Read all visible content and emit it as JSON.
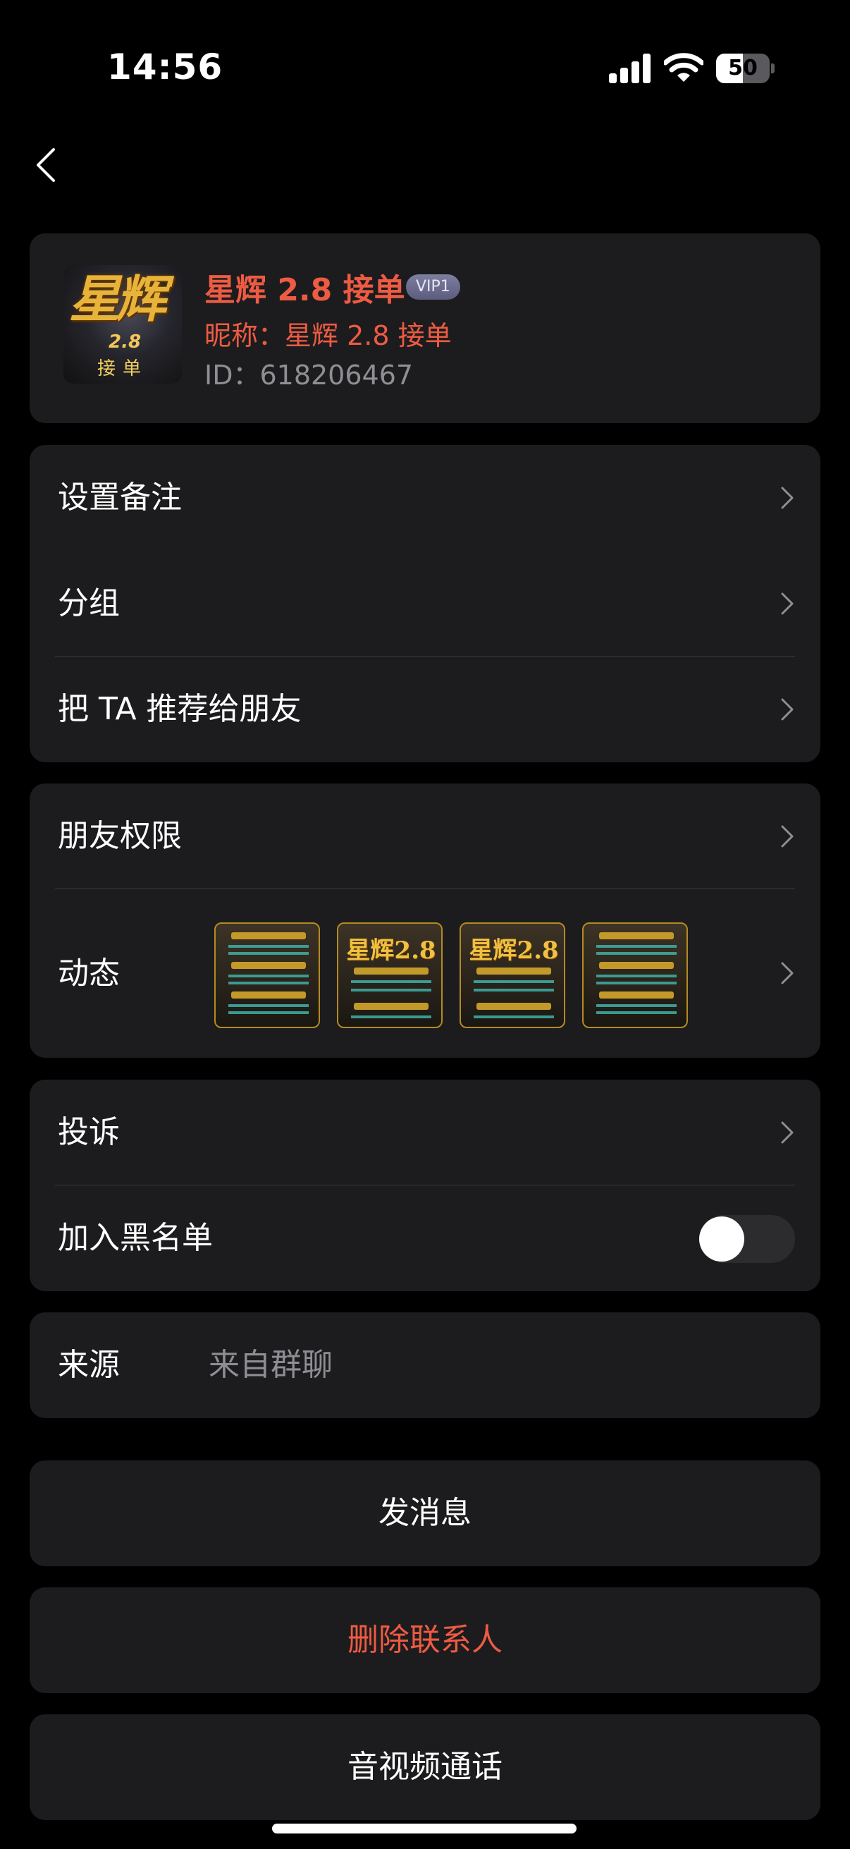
{
  "status_bar": {
    "time": "14:56",
    "battery": "50",
    "battery_level": 0.5
  },
  "profile": {
    "avatar_text": "星辉",
    "avatar_version": "2.8",
    "avatar_sub": "接单",
    "name": "星辉 2.8 接单",
    "vip_badge": "VIP1",
    "nickname": "昵称：星辉 2.8 接单",
    "id": "ID：618206467"
  },
  "settings": {
    "remark": "设置备注",
    "group": "分组",
    "recommend": "把 TA 推荐给朋友"
  },
  "privacy": {
    "permissions": "朋友权限",
    "moments": "动态",
    "moment_thumb_title": "星辉2.8"
  },
  "safety": {
    "report": "投诉",
    "blacklist": "加入黑名单",
    "blacklist_on": false
  },
  "source": {
    "label": "来源",
    "value": "来自群聊"
  },
  "actions": {
    "message": "发消息",
    "delete": "删除联系人",
    "call": "音视频通话"
  },
  "colors": {
    "accent_red": "#ee5b43",
    "card": "#1c1c1e",
    "background": "#000000"
  }
}
